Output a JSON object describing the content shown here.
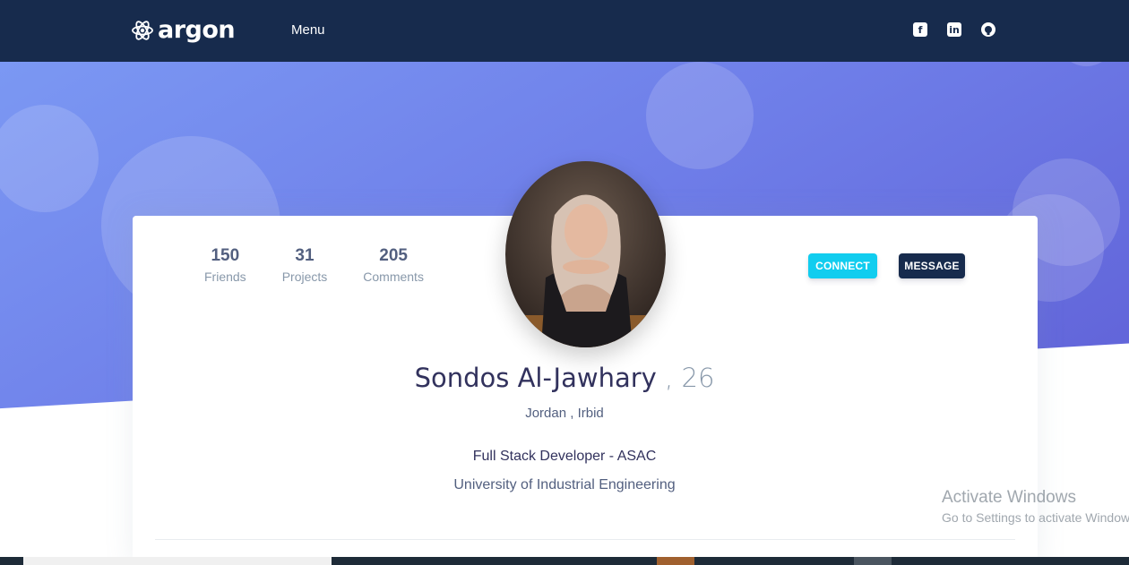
{
  "navbar": {
    "brand": "argon",
    "menu_label": "Menu",
    "social_icons": [
      "facebook-square-icon",
      "linkedin-icon",
      "github-icon"
    ]
  },
  "profile": {
    "stats": [
      {
        "value": "150",
        "label": "Friends"
      },
      {
        "value": "31",
        "label": "Projects"
      },
      {
        "value": "205",
        "label": "Comments"
      }
    ],
    "connect_label": "CONNECT",
    "message_label": "MESSAGE",
    "name": "Sondos Al-Jawhary",
    "age": " , 26",
    "location": "Jordan , Irbid",
    "job": "Full Stack Developer - ASAC",
    "school": "University of Industrial Engineering"
  },
  "watermark": {
    "title": "Activate Windows",
    "subtitle": "Go to Settings to activate Windows."
  },
  "colors": {
    "navbar": "#172b4d",
    "hero_gradient_start": "#7b98f3",
    "hero_gradient_end": "#5f5fd6",
    "connect": "#11cdef",
    "message": "#172b4d"
  }
}
